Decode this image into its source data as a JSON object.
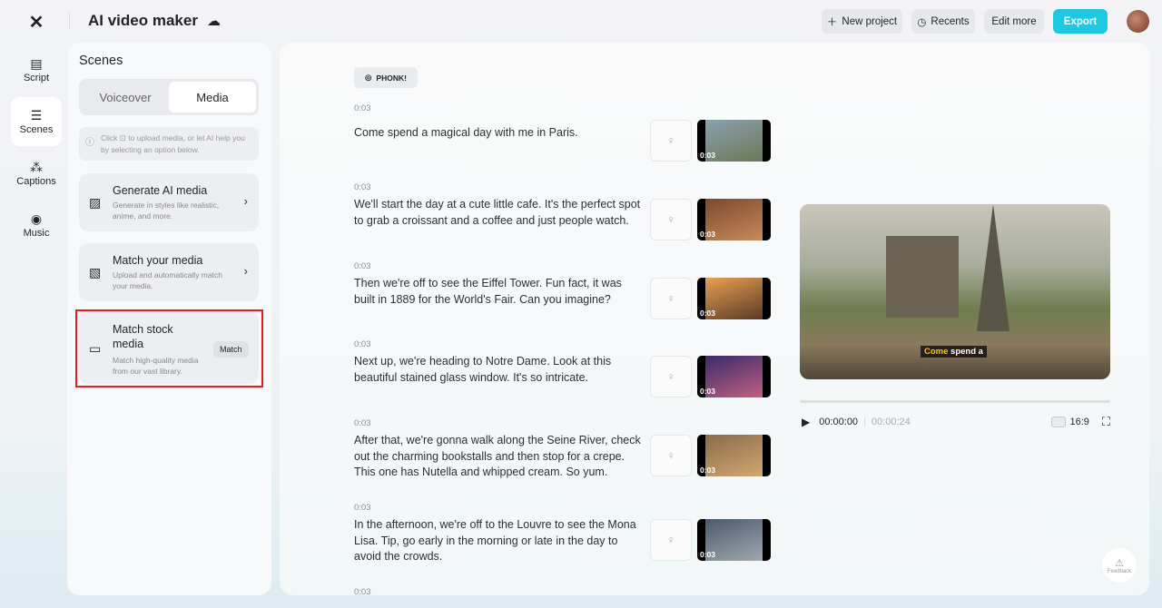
{
  "header": {
    "title": "AI video maker",
    "new_project": "New project",
    "recents": "Recents",
    "edit_more": "Edit more",
    "export": "Export"
  },
  "rail": [
    {
      "label": "Script"
    },
    {
      "label": "Scenes"
    },
    {
      "label": "Captions"
    },
    {
      "label": "Music"
    }
  ],
  "panel": {
    "title": "Scenes",
    "tabs": [
      "Voiceover",
      "Media"
    ],
    "active_tab": "Media",
    "info": "Click ⊡ to upload media, or let AI help you by selecting an option below.",
    "cards": [
      {
        "title": "Generate AI media",
        "desc": "Generate in styles like realistic, anime, and more."
      },
      {
        "title": "Match your media",
        "desc": "Upload and automatically match your media."
      },
      {
        "title": "Match stock media",
        "desc": "Match high-quality media from our vast library.",
        "button": "Match"
      }
    ]
  },
  "music": "PHONK!",
  "scenes": [
    {
      "duration": "0:03",
      "text": "Come spend a magical day with me in Paris.",
      "thumb_duration": "0:03",
      "colors": [
        "#8aa0b0",
        "#6b7a55"
      ]
    },
    {
      "duration": "0:03",
      "text": "We'll start the day at a cute little cafe. It's the perfect spot to grab a croissant and a coffee and just people watch.",
      "thumb_duration": "0:03",
      "colors": [
        "#7a4a2e",
        "#c88a5a"
      ]
    },
    {
      "duration": "0:03",
      "text": "Then we're off to see the Eiffel Tower. Fun fact, it was built in 1889 for the World's Fair. Can you imagine?",
      "thumb_duration": "0:03",
      "colors": [
        "#e8a050",
        "#5a3a28"
      ]
    },
    {
      "duration": "0:03",
      "text": "Next up, we're heading to Notre Dame. Look at this beautiful stained glass window. It's so intricate.",
      "thumb_duration": "0:03",
      "colors": [
        "#3a2a6a",
        "#c06080"
      ]
    },
    {
      "duration": "0:03",
      "text": "After that, we're gonna walk along the Seine River, check out the charming bookstalls and then stop for a crepe. This one has Nutella and whipped cream. So yum.",
      "thumb_duration": "0:03",
      "colors": [
        "#8a6a4a",
        "#d0a870"
      ]
    },
    {
      "duration": "0:03",
      "text": "In the afternoon, we're off to the Louvre to see the Mona Lisa. Tip, go early in the morning or late in the day to avoid the crowds.",
      "thumb_duration": "0:03",
      "colors": [
        "#4a5a6a",
        "#a0a8b0"
      ]
    },
    {
      "duration": "0:03",
      "text": "",
      "thumb_duration": "",
      "colors": [
        "#000",
        "#000"
      ]
    }
  ],
  "preview": {
    "caption_highlight": "Come",
    "caption_rest": " spend a",
    "current": "00:00:00",
    "total": "00:00:24",
    "ratio": "16:9",
    "progress": 0
  },
  "feedback": "Feedback"
}
